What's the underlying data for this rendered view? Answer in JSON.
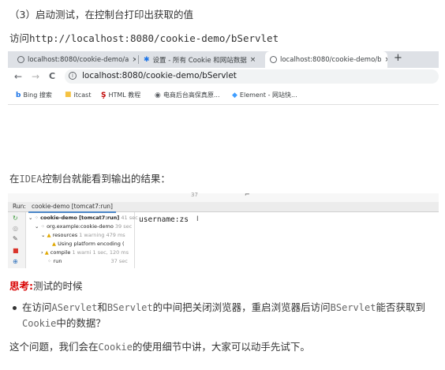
{
  "heading": "（3）启动测试，在控制台打印出获取的值",
  "visit": {
    "prefix": "访问",
    "url": "http://localhost:8080/cookie-demo/bServlet"
  },
  "browser": {
    "tabs": [
      {
        "label": "localhost:8080/cookie-demo/a",
        "icon": "globe-icon"
      },
      {
        "label": "设置 - 所有 Cookie 和网站数据",
        "icon": "gear-icon"
      },
      {
        "label": "localhost:8080/cookie-demo/b",
        "icon": "globe-icon"
      }
    ],
    "close": "×",
    "new_tab": "+",
    "nav": {
      "back": "←",
      "forward": "→",
      "reload": "C"
    },
    "address": "localhost:8080/cookie-demo/bServlet",
    "bookmarks": [
      {
        "label": "Bing 搜索",
        "icon": "bing-icon",
        "color": "#1a73e8"
      },
      {
        "label": "itcast",
        "icon": "folder-icon",
        "color": "#f5c242"
      },
      {
        "label": "HTML 教程",
        "icon": "runoob-icon",
        "color": "#c00000"
      },
      {
        "label": "电商后台高保真原...",
        "icon": "globe-icon",
        "color": "#5f6368"
      },
      {
        "label": "Element - 网站快...",
        "icon": "element-icon",
        "color": "#409eff"
      }
    ]
  },
  "idea_line": {
    "prefix": "在",
    "ide": "IDEA",
    "suffix": "控制台就能看到输出的结果："
  },
  "ide": {
    "line_no": "37",
    "run_label": "Run:",
    "run_tab": "cookie-demo [tomcat7:run]",
    "tree": [
      {
        "text": "cookie-demo [tomcat7:run]",
        "time": "41 sec",
        "bold": true
      },
      {
        "text": "org.example:cookie-demo",
        "time": "39 sec",
        "bold": false
      },
      {
        "text": "resources",
        "time": "1 warning  479 ms",
        "bold": false
      },
      {
        "text": "Using platform encoding (",
        "time": "",
        "bold": false
      },
      {
        "text": "compile",
        "time": "1 warni 1 sec, 120 ms",
        "bold": false
      },
      {
        "text": "run",
        "time": "37 sec",
        "bold": false
      }
    ],
    "console_output": "username:zs",
    "caret": "I"
  },
  "think": {
    "label": "思考",
    "text": "测试的时候"
  },
  "bullet": {
    "p1": "在访问",
    "m1": "AServlet",
    "p2": "和",
    "m2": "BServlet",
    "p3": "的中间把关闭浏览器，重启浏览器后访问",
    "m3": "BServlet",
    "p4": "能否获取到",
    "m4": "Cookie",
    "p5": "中的数据？"
  },
  "final": {
    "p1": "这个问题，我们会在",
    "m1": "Cookie",
    "p2": "的使用细节中讲，大家可以动手先试下。"
  }
}
